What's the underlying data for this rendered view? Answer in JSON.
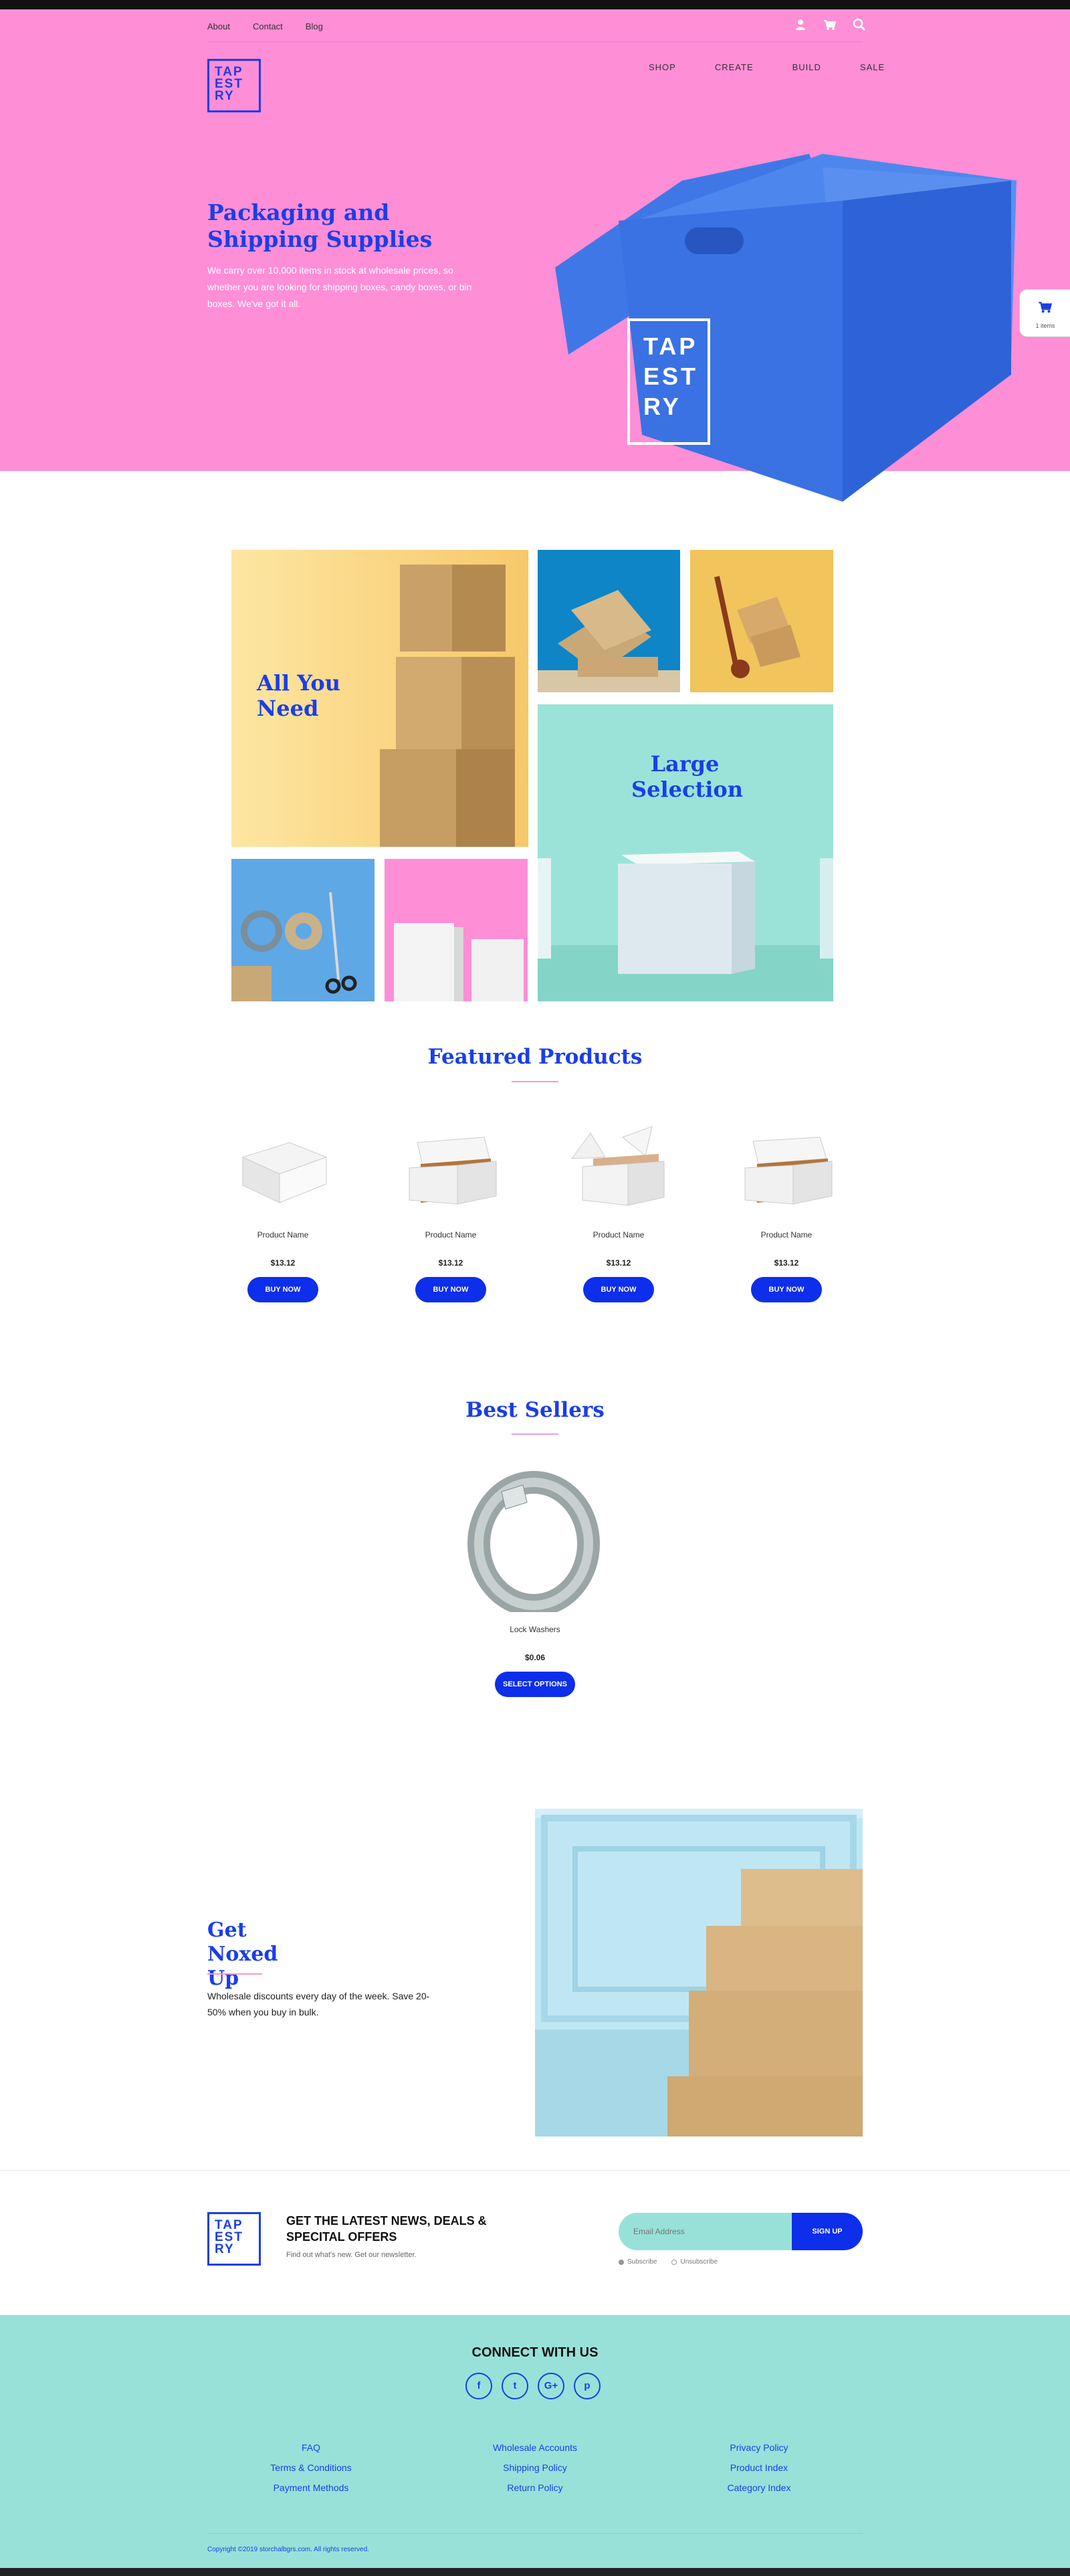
{
  "utility": {
    "links": [
      "About",
      "Contact",
      "Blog"
    ],
    "icons": [
      "user-icon",
      "cart-icon",
      "search-icon"
    ]
  },
  "brand": {
    "logo_lines": [
      "TAP",
      "EST",
      "RY"
    ]
  },
  "nav": [
    "SHOP",
    "CREATE",
    "BUILD",
    "SALE"
  ],
  "hero": {
    "title": "Packaging and Shipping Supplies",
    "text": "We carry over 10,000 items in stock at wholesale prices, so whether you are looking for shipping boxes, candy boxes, or bin boxes. We've got it all."
  },
  "cart_tab": {
    "icon": "cart-icon",
    "label": "1 items"
  },
  "tiles": {
    "all_you_need": "All You Need",
    "large_selection": "Large Selection"
  },
  "featured": {
    "title": "Featured Products",
    "products": [
      {
        "name": "Product Name",
        "price": "$13.12",
        "button": "BUY NOW"
      },
      {
        "name": "Product Name",
        "price": "$13.12",
        "button": "BUY NOW"
      },
      {
        "name": "Product Name",
        "price": "$13.12",
        "button": "BUY NOW"
      },
      {
        "name": "Product Name",
        "price": "$13.12",
        "button": "BUY NOW"
      }
    ]
  },
  "best_sellers": {
    "title": "Best Sellers",
    "product": {
      "name": "Lock Washers",
      "price": "$0.06",
      "button": "SELECT OPTIONS"
    }
  },
  "noxed": {
    "title": "Get Noxed Up",
    "text": "Wholesale discounts every day of the week. Save 20-50% when you buy in bulk."
  },
  "newsletter": {
    "title": "GET THE LATEST NEWS, DEALS & SPECITAL OFFERS",
    "subtitle": "Find out what's new. Get our newsletter.",
    "email_placeholder": "Email Address",
    "button": "SIGN UP",
    "options": [
      "Subscribe",
      "Unsubscribe"
    ]
  },
  "footer": {
    "connect": "CONNECT WITH US",
    "socials": [
      {
        "icon": "facebook-icon",
        "glyph": "f"
      },
      {
        "icon": "twitter-icon",
        "glyph": "t"
      },
      {
        "icon": "google-plus-icon",
        "glyph": "G+"
      },
      {
        "icon": "pinterest-icon",
        "glyph": "p"
      }
    ],
    "columns": [
      [
        "FAQ",
        "Terms & Conditions",
        "Payment Methods"
      ],
      [
        "Wholesale Accounts",
        "Shipping Policy",
        "Return Policy"
      ],
      [
        "Privacy Policy",
        "Product Index",
        "Category Index"
      ]
    ],
    "copyright": "Copyright ©2019 storchalbgrs.com. All rights reserved."
  },
  "colors": {
    "hero_pink": "#fe8ed6",
    "brand_blue": "#1a3ee8",
    "button_blue": "#0d2eea",
    "mint": "#98e1d9"
  }
}
